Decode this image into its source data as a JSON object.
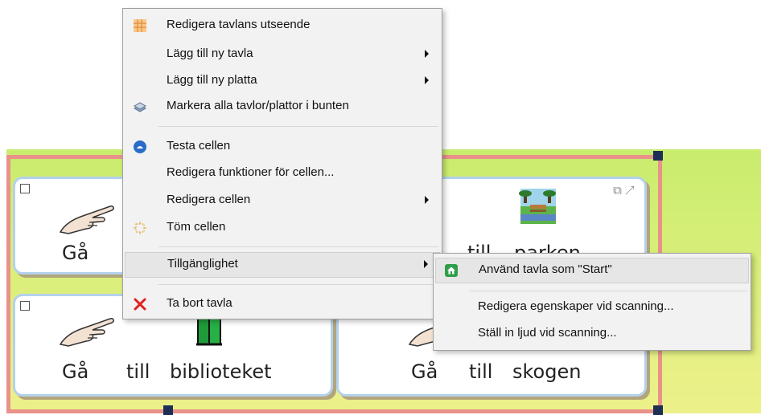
{
  "context_menu": {
    "items": [
      {
        "label": "Redigera tavlans utseende",
        "icon": "grid-icon"
      },
      {
        "label": "Lägg till ny tavla",
        "submenu": true
      },
      {
        "label": "Lägg till ny platta",
        "submenu": true
      },
      {
        "label": "Markera alla tavlor/plattor i bunten",
        "icon": "stack-icon"
      },
      {
        "label": "Testa cellen",
        "icon": "test-icon"
      },
      {
        "label": "Redigera funktioner för cellen..."
      },
      {
        "label": "Redigera cellen",
        "submenu": true
      },
      {
        "label": "Töm cellen",
        "icon": "clear-icon"
      },
      {
        "label": "Tillgänglighet",
        "submenu": true,
        "highlighted": true
      },
      {
        "label": "Ta bort tavla",
        "icon": "delete-icon"
      }
    ]
  },
  "submenu": {
    "items": [
      {
        "label": "Använd tavla som \"Start\"",
        "icon": "home-icon",
        "highlighted": true
      },
      {
        "label": "Redigera egenskaper vid scanning..."
      },
      {
        "label": "Ställ in ljud vid scanning..."
      }
    ]
  },
  "cells": [
    {
      "words": [
        "Gå"
      ]
    },
    {
      "words": [
        "till",
        "parken"
      ]
    },
    {
      "words": [
        "Gå",
        "till",
        "biblioteket"
      ]
    },
    {
      "words": [
        "Gå",
        "till",
        "skogen"
      ]
    }
  ],
  "colors": {
    "board_bg": "#d3ee74",
    "frame": "#e8928a",
    "cell_border": "#b4d1ec",
    "menu_bg": "#f2f2f2",
    "delete_icon": "#e0211f",
    "test_icon": "#2a6cc7",
    "home_icon": "#2f9e4a"
  }
}
